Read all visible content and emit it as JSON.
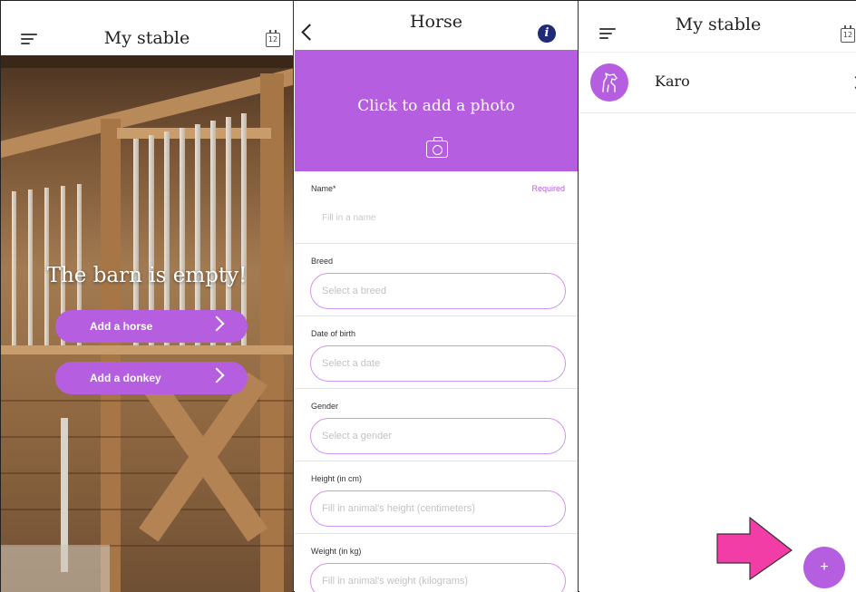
{
  "left_screen": {
    "title": "My stable",
    "calendar_day": "12",
    "empty_message": "The barn is empty!",
    "buttons": [
      {
        "label": "Add a horse"
      },
      {
        "label": "Add a donkey"
      }
    ]
  },
  "middle_screen": {
    "title": "Horse",
    "info_symbol": "i",
    "photo_prompt": "Click to add a photo",
    "fields": [
      {
        "label": "Name*",
        "required_note": "Required",
        "placeholder": "Fill in a name"
      },
      {
        "label": "Breed",
        "placeholder": "Select a breed"
      },
      {
        "label": "Date of birth",
        "placeholder": "Select a date"
      },
      {
        "label": "Gender",
        "placeholder": "Select a gender"
      },
      {
        "label": "Height (in cm)",
        "placeholder": "Fill in animal's height (centimeters)"
      },
      {
        "label": "Weight (in kg)",
        "placeholder": "Fill in animal's weight (kilograms)"
      }
    ]
  },
  "right_screen": {
    "title": "My stable",
    "calendar_day": "12",
    "animals": [
      {
        "name": "Karo",
        "icon": "horse-icon"
      }
    ],
    "fab_label": "+"
  },
  "colors": {
    "accent_purple": "#b65ee0",
    "arrow_pink": "#f23ca6",
    "info_blue": "#1f2a7a"
  }
}
